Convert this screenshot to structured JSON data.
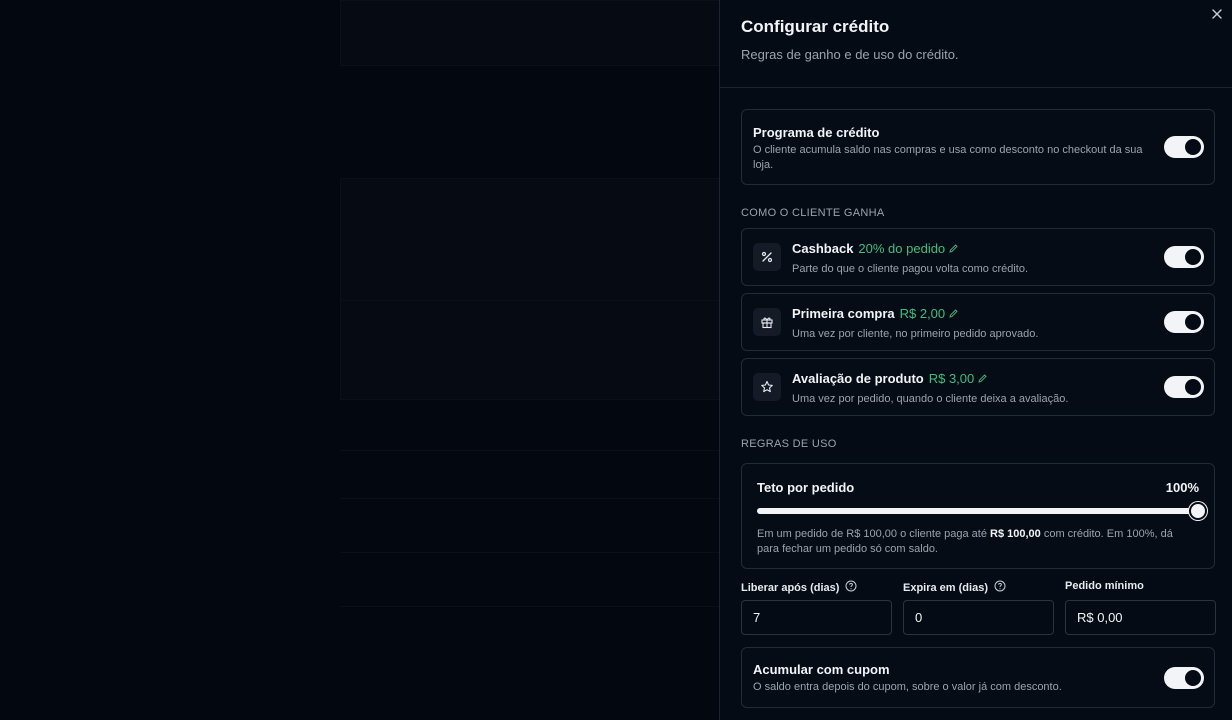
{
  "drawer": {
    "title": "Configurar crédito",
    "subtitle": "Regras de ganho e de uso do crédito."
  },
  "program": {
    "title": "Programa de crédito",
    "description": "O cliente acumula saldo nas compras e usa como desconto no checkout da sua loja.",
    "enabled": true
  },
  "earn_section": {
    "label": "COMO O CLIENTE GANHA",
    "rules": [
      {
        "title": "Cashback",
        "amount": "20% do pedido",
        "description": "Parte do que o cliente pagou volta como crédito.",
        "icon": "percent-icon",
        "enabled": true
      },
      {
        "title": "Primeira compra",
        "amount": "R$ 2,00",
        "description": "Uma vez por cliente, no primeiro pedido aprovado.",
        "icon": "gift-icon",
        "enabled": true
      },
      {
        "title": "Avaliação de produto",
        "amount": "R$ 3,00",
        "description": "Uma vez por pedido, quando o cliente deixa a avaliação.",
        "icon": "star-icon",
        "enabled": true
      }
    ]
  },
  "usage_section": {
    "label": "REGRAS DE USO",
    "cap": {
      "title": "Teto por pedido",
      "value_label": "100%",
      "value_percent": 100,
      "desc_before": "Em um pedido de R$ 100,00 o cliente paga até ",
      "desc_bold": "R$ 100,00",
      "desc_after": " com crédito. Em 100%, dá para fechar um pedido só com saldo."
    },
    "fields": [
      {
        "label": "Liberar após (dias)",
        "value": "7",
        "help": true
      },
      {
        "label": "Expira em (dias)",
        "value": "0",
        "help": true
      },
      {
        "label": "Pedido mínimo",
        "value": "R$ 0,00",
        "help": false
      }
    ],
    "stack": {
      "title": "Acumular com cupom",
      "description": "O saldo entra depois do cupom, sobre o valor já com desconto.",
      "enabled": true
    }
  },
  "colors": {
    "accent_green": "#3fbf7f",
    "toggle_on": "#f2f4f7",
    "drawer_bg": "#050b14"
  }
}
